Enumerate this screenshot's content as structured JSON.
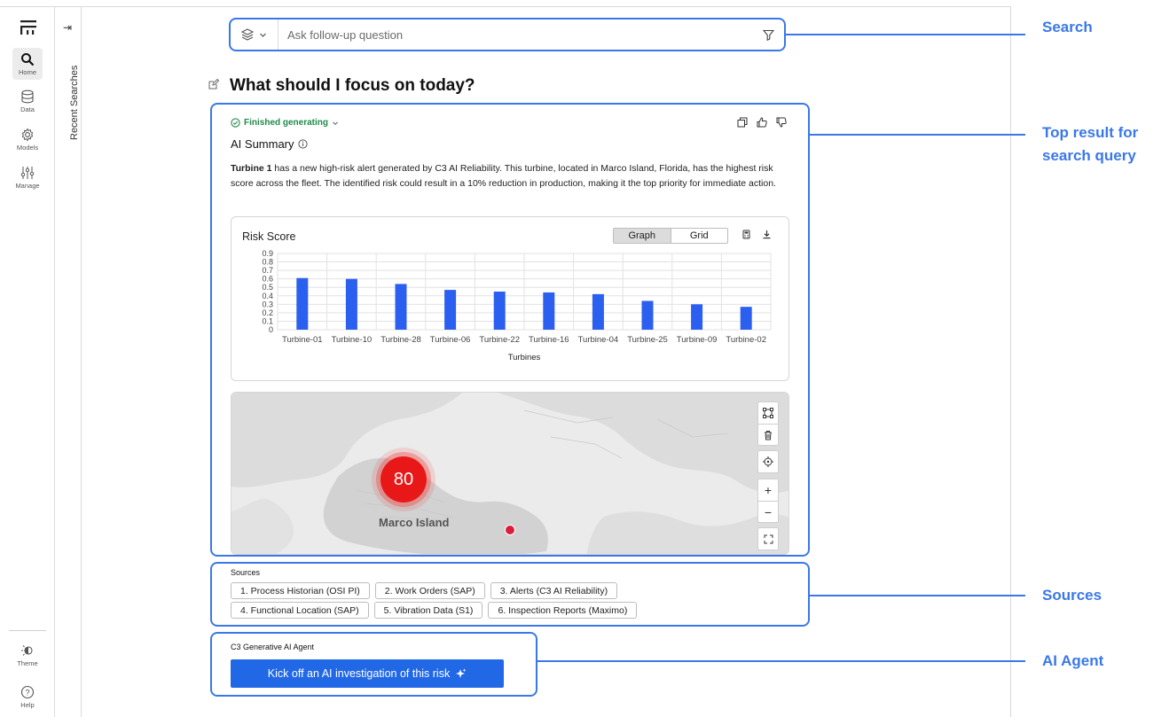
{
  "rail": {
    "items": [
      {
        "label": "Home"
      },
      {
        "label": "Data"
      },
      {
        "label": "Models"
      },
      {
        "label": "Manage"
      }
    ],
    "bottom": [
      {
        "label": "Theme"
      },
      {
        "label": "Help"
      }
    ]
  },
  "recent": {
    "label": "Recent Searches"
  },
  "search": {
    "placeholder": "Ask follow-up question"
  },
  "question": {
    "title": "What should I focus on today?"
  },
  "result": {
    "status": "Finished generating",
    "summary_title": "AI Summary",
    "summary_bold": "Turbine 1",
    "summary_text": " has a new high-risk alert generated by C3 AI Reliability. This turbine, located in Marco Island, Florida, has the highest risk score across the fleet. The identified risk could result in a 10% reduction in production, making it the top priority for immediate action.",
    "toggle": {
      "graph": "Graph",
      "grid": "Grid"
    },
    "map": {
      "cluster_count": "80",
      "place": "Marco Island"
    }
  },
  "chart_data": {
    "type": "bar",
    "title": "Risk Score",
    "xlabel": "Turbines",
    "ylabel": "",
    "categories": [
      "Turbine-01",
      "Turbine-10",
      "Turbine-28",
      "Turbine-06",
      "Turbine-22",
      "Turbine-16",
      "Turbine-04",
      "Turbine-25",
      "Turbine-09",
      "Turbine-02"
    ],
    "values": [
      0.61,
      0.6,
      0.54,
      0.47,
      0.45,
      0.44,
      0.42,
      0.42,
      0.34,
      0.3,
      0.27
    ],
    "yticks": [
      "0.9",
      "0.8",
      "0.7",
      "0.6",
      "0.5",
      "0.4",
      "0.3",
      "0.2",
      "0.1",
      "0"
    ],
    "ylim": [
      0,
      0.9
    ],
    "bar_color": "#2b5ff0",
    "grid": true
  },
  "sources": {
    "title": "Sources",
    "row1": [
      "1. Process Historian (OSI PI)",
      "2. Work Orders (SAP)",
      "3. Alerts (C3 AI Reliability)"
    ],
    "row2": [
      "4. Functional Location (SAP)",
      "5. Vibration Data (S1)",
      "6. Inspection Reports (Maximo)"
    ]
  },
  "agent": {
    "title": "C3 Generative AI Agent",
    "button": "Kick off an AI investigation of this risk"
  },
  "annotations": {
    "search": "Search",
    "top_result_1": "Top result for",
    "top_result_2": "search query",
    "sources": "Sources",
    "agent": "AI Agent"
  },
  "colors": {
    "accent": "#3a78e7",
    "button": "#2168e6",
    "status": "#1e8a4a",
    "alert": "#e81818"
  }
}
